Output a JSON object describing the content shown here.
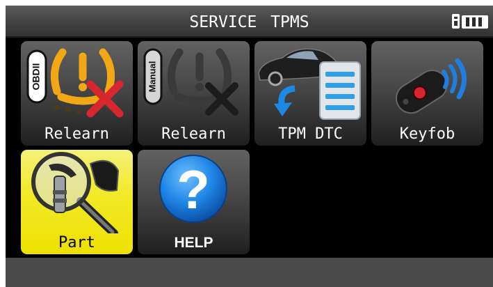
{
  "header": {
    "title": "SERVICE TPMS"
  },
  "status": {
    "icons": [
      "sd-card-icon",
      "battery-icon"
    ]
  },
  "menu": {
    "tiles": [
      {
        "label": "Relearn",
        "badge": "OBDII",
        "icon": "tpms-warning-obdii-icon"
      },
      {
        "label": "Relearn",
        "badge": "Manual",
        "icon": "tpms-warning-manual-icon"
      },
      {
        "label": "TPM DTC",
        "icon": "car-dtc-list-icon"
      },
      {
        "label": "Keyfob",
        "icon": "keyfob-icon"
      },
      {
        "label": "Part",
        "icon": "sensor-magnifier-icon",
        "selected": true
      },
      {
        "label": "HELP",
        "icon": "help-question-icon"
      }
    ]
  },
  "colors": {
    "selected_tile": "#f2ea2a",
    "tpms_symbol": "#f2a814",
    "error_x": "#d8262e",
    "help_blue": "#1f86e6"
  }
}
